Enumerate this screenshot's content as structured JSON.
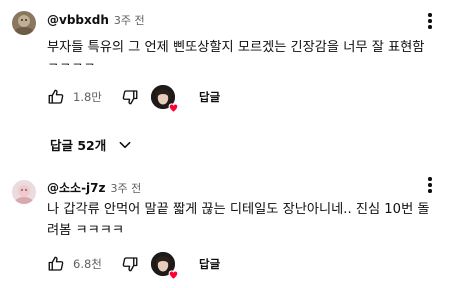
{
  "comments": [
    {
      "author": "@vbbxdh",
      "time": "3주 전",
      "text": "부자들 특유의 그 언제 삔또상할지 모르겠는 긴장감을 너무 잘 표현함\nㅋㅋㅋㅋ",
      "likes": "1.8만",
      "reply_label": "답글"
    },
    {
      "author": "@소소-j7z",
      "time": "3주 전",
      "text": "나 갑각류 안먹어 말끝 짧게 끊는 디테일도 장난아니네.. 진심 10번 돌\n려봄 ㅋㅋㅋㅋ",
      "likes": "6.8천",
      "reply_label": "답글"
    }
  ],
  "replies_toggle": {
    "label": "답글 52개"
  },
  "colors": {
    "heart": "#ff0033",
    "secondary_text": "#606060",
    "primary_text": "#0f0f0f"
  },
  "icons": [
    "like-icon",
    "dislike-icon",
    "more-vert-icon",
    "heart-icon",
    "chevron-down-icon"
  ]
}
